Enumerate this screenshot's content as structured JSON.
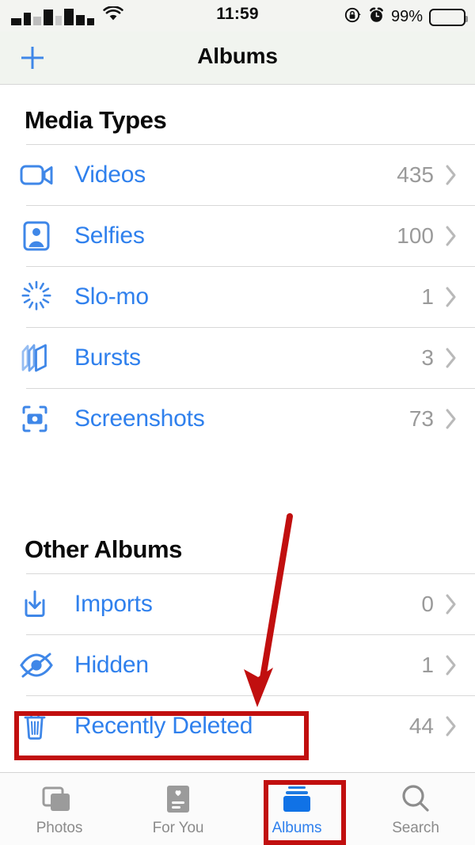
{
  "status_bar": {
    "carrier_redacted": true,
    "wifi_icon": "wifi-icon",
    "time": "11:59",
    "rotation_lock_icon": "rotation-lock-icon",
    "alarm_icon": "alarm-clock-icon",
    "battery_percent": "99%"
  },
  "nav": {
    "add_icon": "plus-icon",
    "title": "Albums"
  },
  "sections": [
    {
      "id": "media-types",
      "header": "Media Types",
      "rows": [
        {
          "icon": "video-camera-icon",
          "label": "Videos",
          "count": "435"
        },
        {
          "icon": "selfie-person-icon",
          "label": "Selfies",
          "count": "100"
        },
        {
          "icon": "slo-mo-icon",
          "label": "Slo-mo",
          "count": "1"
        },
        {
          "icon": "bursts-stack-icon",
          "label": "Bursts",
          "count": "3"
        },
        {
          "icon": "screenshot-icon",
          "label": "Screenshots",
          "count": "73"
        }
      ]
    },
    {
      "id": "other-albums",
      "header": "Other Albums",
      "rows": [
        {
          "icon": "import-download-icon",
          "label": "Imports",
          "count": "0"
        },
        {
          "icon": "eye-slash-icon",
          "label": "Hidden",
          "count": "1"
        },
        {
          "icon": "trash-icon",
          "label": "Recently Deleted",
          "count": "44"
        }
      ]
    }
  ],
  "tabbar": {
    "tabs": [
      {
        "icon": "photos-stack-icon",
        "label": "Photos",
        "active": false
      },
      {
        "icon": "for-you-card-icon",
        "label": "For You",
        "active": false
      },
      {
        "icon": "albums-folder-icon",
        "label": "Albums",
        "active": true
      },
      {
        "icon": "search-icon",
        "label": "Search",
        "active": false
      }
    ]
  },
  "annotations": {
    "highlight_color": "#c10f0f",
    "arrow_color": "#c10f0f",
    "highlight_recently_deleted": true,
    "highlight_albums_tab": true,
    "arrow_points_to": "Recently Deleted"
  },
  "colors": {
    "tint_blue": "#2f80ed",
    "icon_blue": "#3f87e8",
    "count_gray": "#9a9a9a",
    "annotation_red": "#c10f0f"
  }
}
